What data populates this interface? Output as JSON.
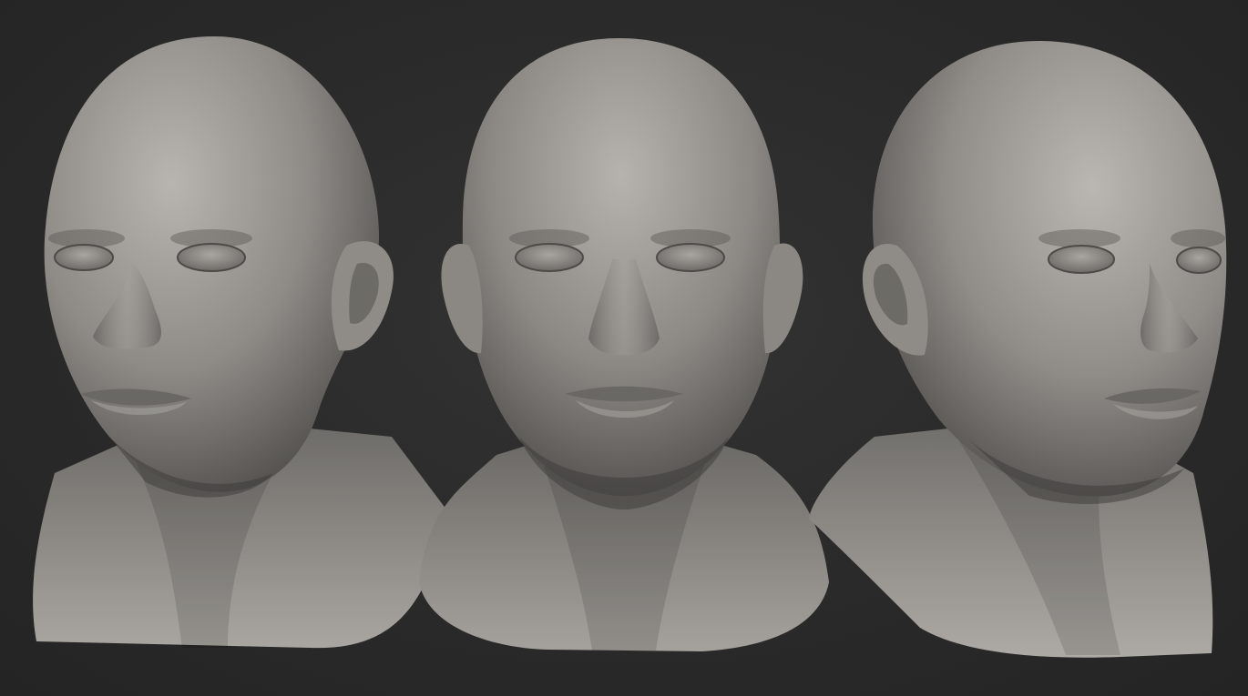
{
  "scene": {
    "subject": "sculpted-male-head",
    "views": [
      {
        "id": "three-quarter-left"
      },
      {
        "id": "front"
      },
      {
        "id": "three-quarter-right"
      }
    ]
  },
  "colors": {
    "background": "#2b2b2b",
    "clay_light": "#b4b1ac",
    "clay_mid": "#8d8a86",
    "clay_dark": "#5a5855",
    "clay_shadow": "#3b3a38"
  }
}
